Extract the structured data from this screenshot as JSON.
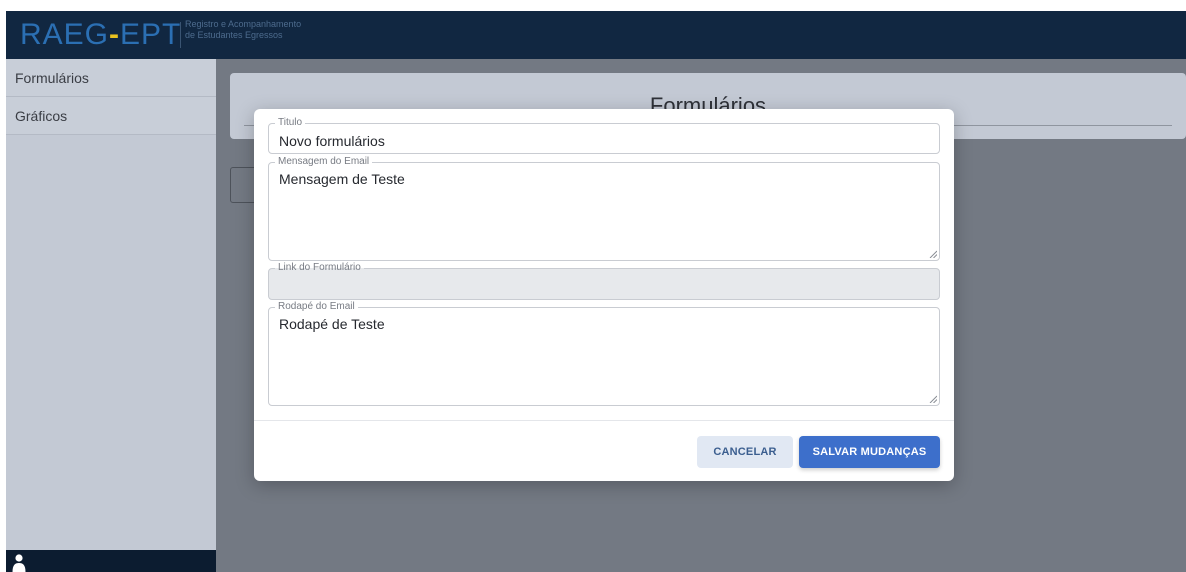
{
  "header": {
    "logo_left": "RAEG",
    "logo_dash": "-",
    "logo_right": "EPT",
    "subtitle_line1": "Registro e Acompanhamento",
    "subtitle_line2": "de Estudantes Egressos"
  },
  "sidebar": {
    "items": [
      {
        "label": "Formulários"
      },
      {
        "label": "Gráficos"
      }
    ],
    "footer_icon": "user-icon"
  },
  "main": {
    "page_title": "Formulários"
  },
  "modal": {
    "fields": {
      "titulo": {
        "label": "Titulo",
        "value": "Novo formulários"
      },
      "mensagem": {
        "label": "Mensagem do Email",
        "value": "Mensagem de Teste"
      },
      "link": {
        "label": "Link do Formulário",
        "value": ""
      },
      "rodape": {
        "label": "Rodapé do Email",
        "value": "Rodapé de Teste"
      }
    },
    "buttons": {
      "cancel_label": "CANCELAR",
      "save_label": "SALVAR MUDANÇAS"
    }
  },
  "colors": {
    "header_bg": "#112741",
    "logo_blue": "#2b6fb3",
    "logo_accent": "#e9c21f",
    "primary_button": "#3d6fcb",
    "secondary_button": "#e1e8f3"
  }
}
